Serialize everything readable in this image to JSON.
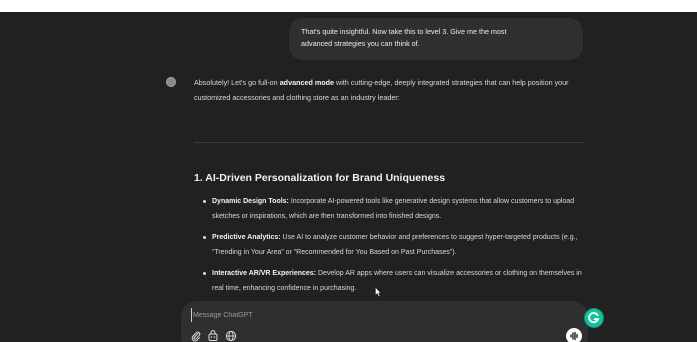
{
  "user_message": {
    "line1": "That's quite insightful. Now take this to level 3. Give me the most",
    "line2": "advanced strategies you can think of."
  },
  "assistant": {
    "intro_part1": "Absolutely! Let's go full-on ",
    "intro_bold": "advanced mode",
    "intro_part2": " with cutting-edge, deeply integrated strategies that can help position your customized accessories and clothing store as an industry leader:",
    "section_heading": "1. AI-Driven Personalization for Brand Uniqueness",
    "bullets": [
      {
        "title": "Dynamic Design Tools:",
        "text": " Incorporate AI-powered tools like generative design systems that allow customers to upload sketches or inspirations, which are then transformed into finished designs."
      },
      {
        "title": "Predictive Analytics:",
        "text": " Use AI to analyze customer behavior and preferences to suggest hyper-targeted products (e.g., “Trending in Your Area” or “Recommended for You Based on Past Purchases”)."
      },
      {
        "title": "Interactive AR/VR Experiences:",
        "text": " Develop AR apps where users can visualize accessories or clothing on themselves in real time, enhancing confidence in purchasing."
      }
    ]
  },
  "composer": {
    "placeholder": "Message ChatGPT"
  },
  "icons": {
    "attach": "paperclip-icon",
    "tools": "tools-icon",
    "search": "globe-icon",
    "voice": "voice-waveform-icon",
    "grammarly": "grammarly-icon"
  },
  "colors": {
    "background": "#212121",
    "bubble": "#2f2f2f",
    "grammarly": "#15c39a"
  }
}
